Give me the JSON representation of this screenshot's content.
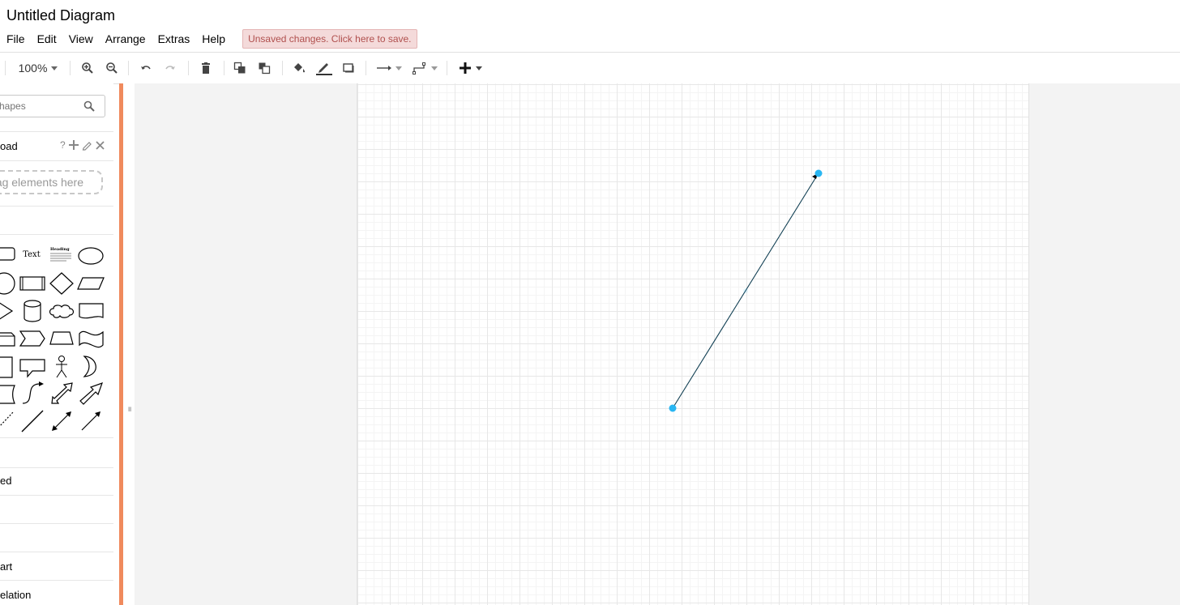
{
  "app": {
    "title": "Untitled Diagram",
    "save_notice": "Unsaved changes. Click here to save."
  },
  "menu": [
    "File",
    "Edit",
    "View",
    "Arrange",
    "Extras",
    "Help"
  ],
  "toolbar": {
    "zoom": "100%"
  },
  "sidebar": {
    "search_placeholder": "hapes",
    "scratchpad_label": "oad",
    "scratchpad_help": "?",
    "drag_hint": "ag elements here",
    "text_shape_label": "Text",
    "heading_shape_label": "Heading",
    "sections": [
      "ed",
      "art",
      "elation"
    ]
  },
  "colors": {
    "accent": "#f08a5d",
    "selection": "#29b6f2",
    "save_bg": "#f4dada",
    "save_text": "#b0504e"
  }
}
